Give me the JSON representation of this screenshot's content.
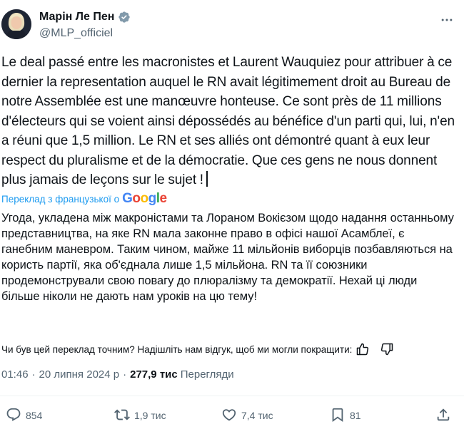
{
  "author": {
    "display_name": "Марін Ле Пен",
    "handle": "@MLP_officiel",
    "verified": true,
    "verified_color": "#829aab"
  },
  "tweet": {
    "original_text": "Le deal passé entre les macronistes et Laurent Wauquiez pour attribuer à ce dernier la representation auquel le RN avait légitimement droit au Bureau de notre Assemblée est une manœuvre honteuse. Ce sont près de 11 millions d'électeurs qui se voient ainsi dépossédés au bénéfice d'un parti qui, lui, n'en a réuni que 1,5 million. Le RN et ses alliés ont démontré quant à eux leur respect du pluralisme et de la démocratie. Que ces gens ne nous donnent plus jamais de leçons sur le sujet !",
    "translated_by": "Переклад з французької о",
    "google_logo": "Google",
    "translation_text": "Угода, укладена між макроністами та Лораном Вокієзом щодо надання останньому представництва, на яке RN мала законне право в офісі нашої Асамблеї, є ганебним маневром. Таким чином, майже 11 мільйонів виборців позбавляються на користь партії, яка об'єднала лише 1,5 мільйона. RN та її союзники продемонстрували свою повагу до плюралізму та демократії. Нехай ці люди більше ніколи не дають нам уроків на цю тему!",
    "feedback_prompt": "Чи був цей переклад точним? Надішліть нам відгук, щоб ми могли покращити:"
  },
  "meta": {
    "time": "01:46",
    "separator": "·",
    "date": "20 липня 2024 р",
    "views_count": "277,9 тис",
    "views_label": "Перегляди"
  },
  "actions": {
    "replies": "854",
    "reposts": "1,9 тис",
    "likes": "7,4 тис",
    "bookmarks": "81"
  },
  "colors": {
    "text": "#0f1419",
    "secondary": "#536471",
    "link": "#1d9bf0",
    "divider": "#eff3f4"
  }
}
